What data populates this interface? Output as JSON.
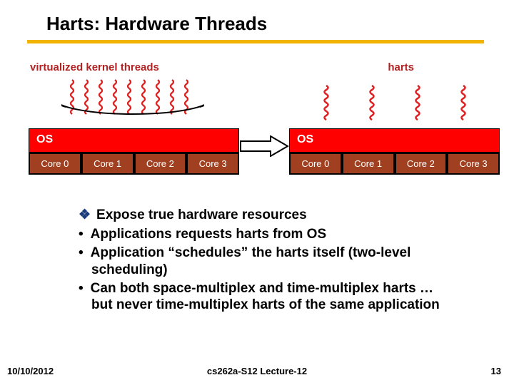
{
  "title": "Harts: Hardware Threads",
  "left_label": "virtualized kernel threads",
  "right_label": "harts",
  "os_label": "OS",
  "cores": [
    "Core 0",
    "Core 1",
    "Core 2",
    "Core 3"
  ],
  "lead_bullet": "Expose true hardware resources",
  "sub_bullets": [
    "Applications requests harts from OS",
    "Application “schedules” the harts itself (two-level scheduling)",
    "Can both space-multiplex and time-multiplex harts … but never time-multiplex harts of the same application"
  ],
  "footer": {
    "date": "10/10/2012",
    "center": "cs262a-S12 Lecture-12",
    "page": "13"
  },
  "chart_data": {
    "type": "diagram",
    "description": "Two system stacks side by side with an arrow from left to right. Left stack: 9 overlapping red spring-coil threads above a red 'OS' band above four brown boxes labeled Core 0..3, with a black ellipse mapping the 9 threads down onto the cores. Right stack: 4 separated red spring-coil harts, one per core, above the same OS band and Core 0..3 boxes.",
    "left": {
      "thread_count": 9,
      "mapped_to_cores": 4,
      "label": "virtualized kernel threads"
    },
    "right": {
      "hart_count": 4,
      "mapped_to_cores": 4,
      "label": "harts"
    },
    "os_label": "OS",
    "cores": [
      "Core 0",
      "Core 1",
      "Core 2",
      "Core 3"
    ]
  }
}
